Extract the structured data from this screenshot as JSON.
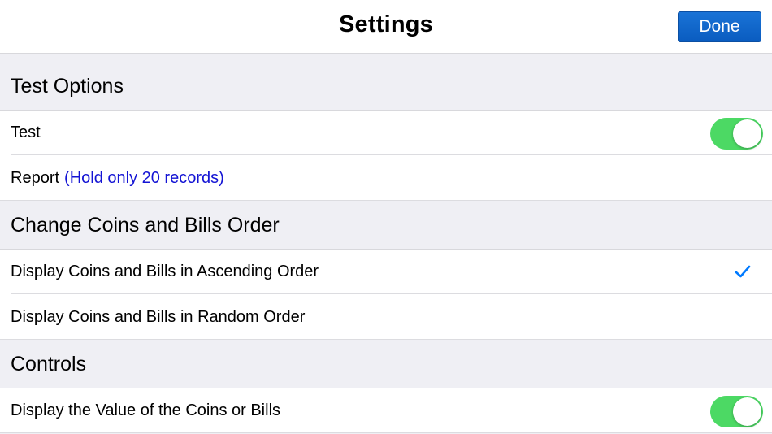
{
  "navbar": {
    "title": "Settings",
    "done_label": "Done"
  },
  "sections": {
    "test_options": {
      "header": "Test Options",
      "test_label": "Test",
      "test_enabled": true,
      "report_label": "Report",
      "report_note": "(Hold only 20 records)"
    },
    "order": {
      "header": "Change Coins and Bills Order",
      "ascending_label": "Display Coins and Bills in Ascending Order",
      "ascending_selected": true,
      "random_label": "Display Coins and Bills in Random Order"
    },
    "controls": {
      "header": "Controls",
      "display_value_label": "Display the Value of the Coins or Bills",
      "display_value_enabled": true
    }
  },
  "colors": {
    "accent": "#0a5cc0",
    "toggle_on": "#4cd964",
    "note": "#1414d4",
    "checkmark": "#007aff"
  }
}
